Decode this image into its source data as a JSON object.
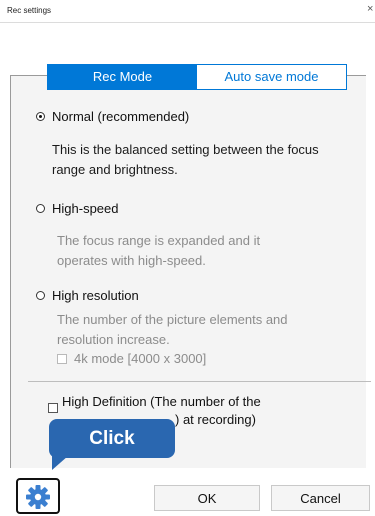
{
  "window": {
    "title": "Rec settings",
    "close_glyph": "×"
  },
  "tabs": [
    {
      "label": "Rec Mode",
      "active": true
    },
    {
      "label": "Auto save mode",
      "active": false
    }
  ],
  "options": {
    "normal": {
      "label": "Normal (recommended)",
      "selected": true,
      "description_line1": "This is the balanced setting between the focus",
      "description_line2": "range and brightness."
    },
    "high_speed": {
      "label": "High-speed",
      "selected": false,
      "description_line1": "The focus range is expanded and it",
      "description_line2": "operates with high-speed."
    },
    "high_resolution": {
      "label": "High resolution",
      "selected": false,
      "description_line1": "The number of the picture elements and",
      "description_line2": "resolution increase.",
      "sub_checkbox_label": "4k mode [4000 x 3000]"
    }
  },
  "high_definition": {
    "label_line1": "High Definition (The number of the",
    "label_line2_visible": ") at recording)"
  },
  "buttons": {
    "ok": "OK",
    "cancel": "Cancel"
  },
  "settings_button": {
    "icon": "gear-icon"
  },
  "callout": {
    "text": "Click"
  },
  "colors": {
    "accent": "#0078d7",
    "callout": "#2a67b0"
  }
}
